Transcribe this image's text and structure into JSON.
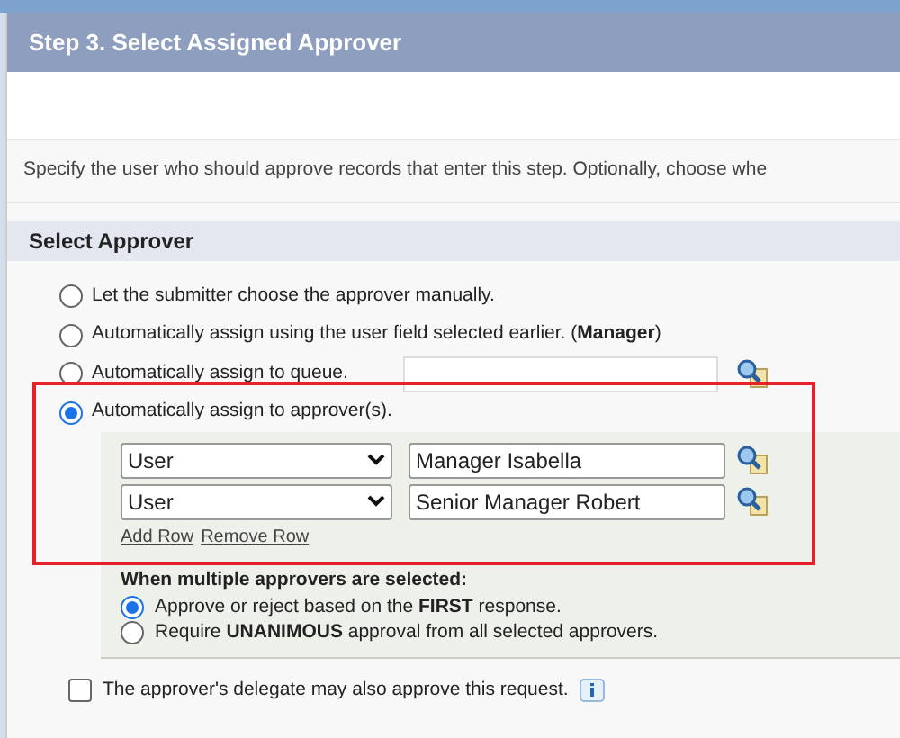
{
  "step_header": {
    "title": "Step 3. Select Assigned Approver"
  },
  "description": "Specify the user who should approve records that enter this step. Optionally, choose whe",
  "section": {
    "title": "Select Approver"
  },
  "approver_options": [
    {
      "label": "Let the submitter choose the approver manually.",
      "selected": false,
      "kind": "plain"
    },
    {
      "label": "Automatically assign using the user field selected earlier. (**Manager**)",
      "selected": false,
      "kind": "plain"
    },
    {
      "label": "Automatically assign to queue.",
      "selected": false,
      "kind": "queue"
    },
    {
      "label": "Automatically assign to approver(s).",
      "selected": true,
      "kind": "approvers"
    }
  ],
  "approvers": [
    {
      "type": "User",
      "name": "Manager Isabella"
    },
    {
      "type": "User",
      "name": "Senior Manager Robert"
    }
  ],
  "row_links": [
    "Add Row",
    "Remove Row"
  ],
  "multiple": {
    "heading": "When multiple approvers are selected:",
    "options": [
      {
        "label": "Approve or reject based on the **FIRST** response.",
        "selected": true
      },
      {
        "label": "Require **UNANIMOUS** approval from all selected approvers.",
        "selected": false
      }
    ]
  },
  "delegate": {
    "label": "The approver's delegate may also approve this request.",
    "checked": false
  }
}
